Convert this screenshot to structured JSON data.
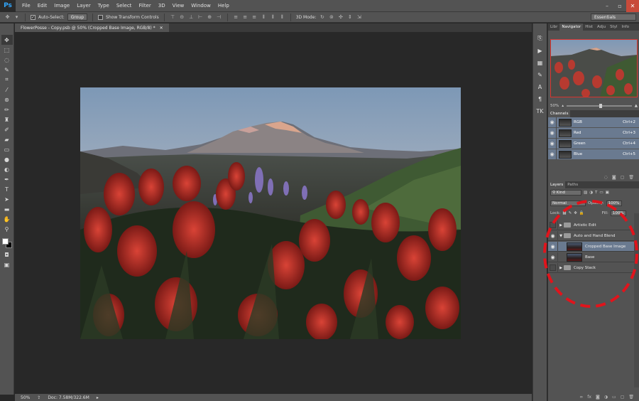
{
  "app": {
    "logo": "Ps",
    "menu": [
      "File",
      "Edit",
      "Image",
      "Layer",
      "Type",
      "Select",
      "Filter",
      "3D",
      "View",
      "Window",
      "Help"
    ]
  },
  "options_bar": {
    "auto_select_label": "Auto-Select:",
    "auto_select_value": "Group",
    "show_transform_label": "Show Transform Controls",
    "mode_3d_label": "3D Mode:",
    "workspace": "Essentials"
  },
  "document": {
    "tab_title": "FlowerPosse - Copy.psb @ 50% (Cropped Base Image, RGB/8) *",
    "zoom": "50%",
    "doc_size": "Doc: 7.58M/322.6M"
  },
  "navigator": {
    "tabs": [
      "Libr",
      "Navigator",
      "Hist",
      "Adju",
      "Styl",
      "Info"
    ],
    "active_tab": "Navigator",
    "zoom": "50%"
  },
  "channels": {
    "tab": "Channels",
    "rows": [
      {
        "name": "RGB",
        "shortcut": "Ctrl+2"
      },
      {
        "name": "Red",
        "shortcut": "Ctrl+3"
      },
      {
        "name": "Green",
        "shortcut": "Ctrl+4"
      },
      {
        "name": "Blue",
        "shortcut": "Ctrl+5"
      }
    ]
  },
  "layers": {
    "tabs": [
      "Layers",
      "Paths"
    ],
    "filter_kind": "Kind",
    "blend_mode": "Normal",
    "opacity_label": "Opacity:",
    "opacity": "100%",
    "lock_label": "Lock:",
    "fill_label": "Fill:",
    "fill": "100%",
    "rows": [
      {
        "name": "Artistic Edit",
        "type": "group"
      },
      {
        "name": "Auto and Hand Blend",
        "type": "group"
      },
      {
        "name": "Cropped Base Image",
        "type": "layer"
      },
      {
        "name": "Base",
        "type": "layer"
      },
      {
        "name": "Copy Stack",
        "type": "group"
      }
    ]
  },
  "colors": {
    "chrome": "#535353",
    "canvas": "#282828",
    "selection": "#6a7a90",
    "annotation": "#e0141c",
    "ps_blue": "#31a8ff"
  }
}
